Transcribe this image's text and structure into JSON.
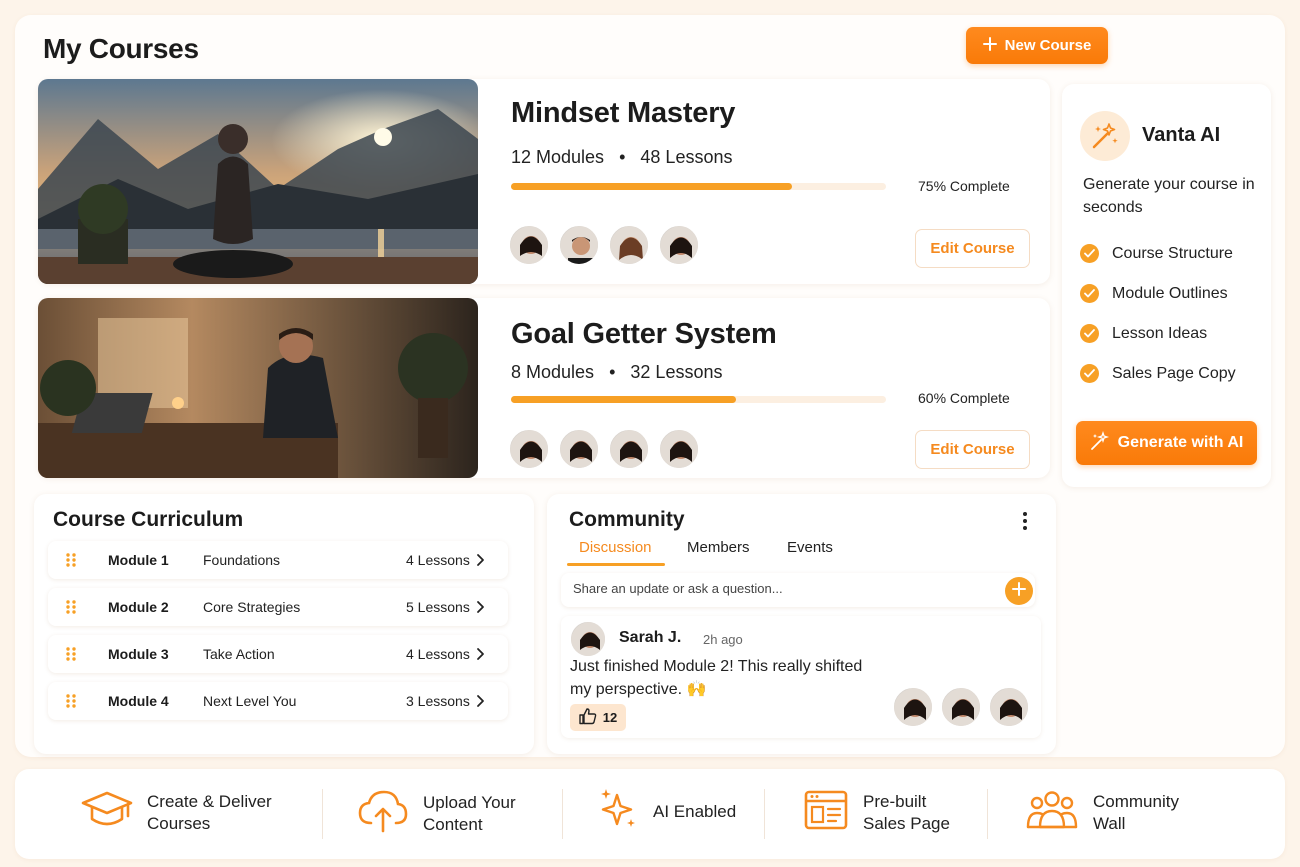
{
  "page": {
    "title": "My Courses",
    "new_course_label": "New Course"
  },
  "courses": [
    {
      "title": "Mindset Mastery",
      "modules": "12 Modules",
      "separator": "•",
      "lessons": "48 Lessons",
      "progress_pct": 75,
      "progress_label": "75% Complete",
      "edit_label": "Edit Course"
    },
    {
      "title": "Goal Getter System",
      "modules": "8 Modules",
      "separator": "•",
      "lessons": "32 Lessons",
      "progress_pct": 60,
      "progress_label": "60% Complete",
      "edit_label": "Edit Course"
    }
  ],
  "ai_panel": {
    "title": "Vanta AI",
    "description": "Generate your course in seconds",
    "features": [
      "Course Structure",
      "Module Outlines",
      "Lesson Ideas",
      "Sales Page Copy"
    ],
    "generate_label": "Generate with AI"
  },
  "curriculum": {
    "title": "Course Curriculum",
    "modules": [
      {
        "number": "Module 1",
        "name": "Foundations",
        "lessons": "4 Lessons"
      },
      {
        "number": "Module 2",
        "name": "Core Strategies",
        "lessons": "5 Lessons"
      },
      {
        "number": "Module 3",
        "name": "Take Action",
        "lessons": "4 Lessons"
      },
      {
        "number": "Module 4",
        "name": "Next Level You",
        "lessons": "3 Lessons"
      }
    ]
  },
  "community": {
    "title": "Community",
    "tabs": [
      "Discussion",
      "Members",
      "Events"
    ],
    "active_tab": "Discussion",
    "share_placeholder": "Share an update or ask a question...",
    "post": {
      "author": "Sarah J.",
      "time": "2h ago",
      "text": "Just finished Module 2! This really shifted my perspective. 🙌",
      "likes": "12"
    }
  },
  "footer": {
    "items": [
      {
        "icon": "graduation-cap-icon",
        "label": "Create & Deliver Courses"
      },
      {
        "icon": "cloud-upload-icon",
        "label": "Upload Your Content"
      },
      {
        "icon": "sparkles-icon",
        "label": "AI Enabled"
      },
      {
        "icon": "sales-page-icon",
        "label": "Pre-built Sales Page"
      },
      {
        "icon": "community-icon",
        "label": "Community Wall"
      }
    ]
  },
  "colors": {
    "accent": "#f7a025",
    "accent_dark": "#f97a08",
    "background": "#fdf4ea"
  }
}
